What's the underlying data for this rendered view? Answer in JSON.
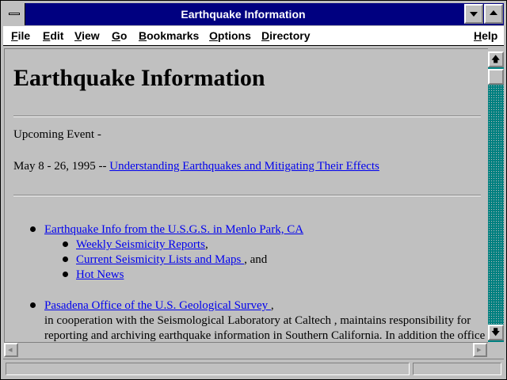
{
  "window": {
    "title": "Earthquake Information"
  },
  "menu": [
    "File",
    "Edit",
    "View",
    "Go",
    "Bookmarks",
    "Options",
    "Directory",
    "Help"
  ],
  "page": {
    "heading": "Earthquake Information",
    "upcoming_label": "Upcoming Event -",
    "event_date": "May 8 - 26, 1995 --",
    "event_link": "Understanding Earthquakes and Mitigating Their Effects",
    "usgs_link": "Earthquake Info from the U.S.G.S. in Menlo Park, CA",
    "sub_items": [
      {
        "link": "Weekly Seismicity Reports",
        "suffix": ","
      },
      {
        "link": "Current Seismicity Lists and Maps ",
        "suffix": ", and"
      },
      {
        "link": "Hot News",
        "suffix": ""
      }
    ],
    "pasadena_link": "Pasadena Office of the U.S. Geological Survey ",
    "pasadena_suffix": ",",
    "pasadena_text_1": "in cooperation with the Seismological Laboratory at Caltech , maintains responsibility for",
    "pasadena_text_2": "reporting and archiving earthquake information in Southern California. In addition the office"
  },
  "scrollbar": {
    "up_arrow": "🡅",
    "down_arrow": "🡇",
    "left_arrow": "◂",
    "right_arrow": "▸"
  },
  "icons": {
    "system_menu": "system-menu-icon",
    "minimize": "minimize-icon",
    "maximize": "maximize-icon"
  }
}
